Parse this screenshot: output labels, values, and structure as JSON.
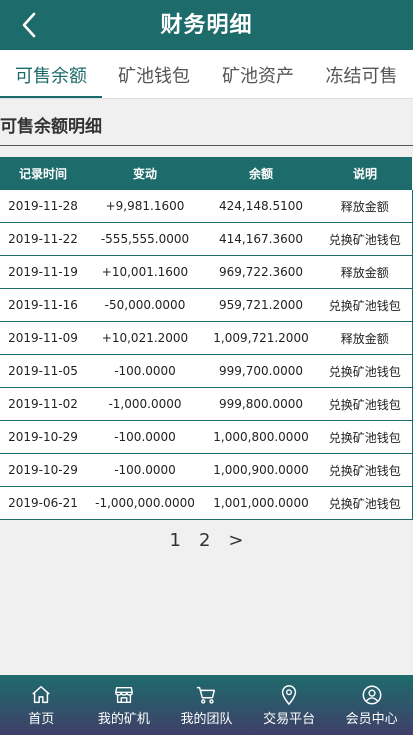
{
  "header": {
    "title": "财务明细"
  },
  "tabs": [
    {
      "label": "可售余额",
      "active": true
    },
    {
      "label": "矿池钱包",
      "active": false
    },
    {
      "label": "矿池资产",
      "active": false
    },
    {
      "label": "冻结可售",
      "active": false
    }
  ],
  "section": {
    "title": "可售余额明细"
  },
  "table": {
    "columns": [
      "记录时间",
      "变动",
      "余额",
      "说明"
    ],
    "rows": [
      [
        "2019-11-28",
        "+9,981.1600",
        "424,148.5100",
        "释放金额"
      ],
      [
        "2019-11-22",
        "-555,555.0000",
        "414,167.3600",
        "兑换矿池钱包"
      ],
      [
        "2019-11-19",
        "+10,001.1600",
        "969,722.3600",
        "释放金额"
      ],
      [
        "2019-11-16",
        "-50,000.0000",
        "959,721.2000",
        "兑换矿池钱包"
      ],
      [
        "2019-11-09",
        "+10,021.2000",
        "1,009,721.2000",
        "释放金额"
      ],
      [
        "2019-11-05",
        "-100.0000",
        "999,700.0000",
        "兑换矿池钱包"
      ],
      [
        "2019-11-02",
        "-1,000.0000",
        "999,800.0000",
        "兑换矿池钱包"
      ],
      [
        "2019-10-29",
        "-100.0000",
        "1,000,800.0000",
        "兑换矿池钱包"
      ],
      [
        "2019-10-29",
        "-100.0000",
        "1,000,900.0000",
        "兑换矿池钱包"
      ],
      [
        "2019-06-21",
        "-1,000,000.0000",
        "1,001,000.0000",
        "兑换矿池钱包"
      ]
    ]
  },
  "pagination": {
    "pages": [
      "1",
      "2"
    ],
    "next": ">"
  },
  "bottom_nav": [
    {
      "label": "首页",
      "icon": "home-icon"
    },
    {
      "label": "我的矿机",
      "icon": "store-icon"
    },
    {
      "label": "我的团队",
      "icon": "cart-icon"
    },
    {
      "label": "交易平台",
      "icon": "location-pin-icon"
    },
    {
      "label": "会员中心",
      "icon": "user-icon"
    }
  ],
  "colors": {
    "primary": "#1e6b6c",
    "nav_gradient_end": "#3f3f68",
    "background": "#f0f0f0"
  }
}
